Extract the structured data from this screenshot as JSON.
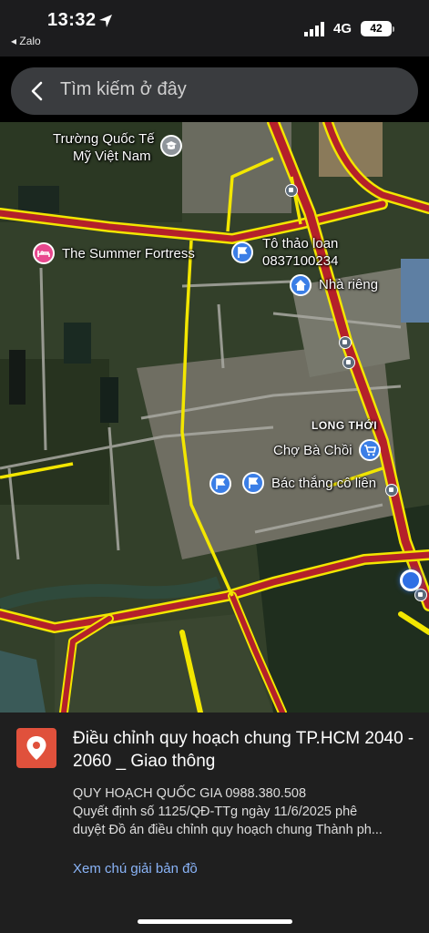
{
  "status_bar": {
    "time": "13:32",
    "back_app": "◂ Zalo",
    "network": "4G",
    "battery": "42"
  },
  "search": {
    "placeholder": "Tìm kiếm ở đây"
  },
  "map": {
    "labels": {
      "school_line1": "Trường Quốc Tế",
      "school_line2": "Mỹ Việt Nam",
      "summer_fortress": "The Summer Fortress",
      "to_thao_loan_line1": "Tô thảo loan",
      "to_thao_loan_line2": "0837100234",
      "nha_rieng": "Nhà riêng",
      "long_thoi": "LONG THỚI",
      "cho_ba_choi": "Chợ Bà Chồi",
      "bac_thang": "Bác thắng cô liên"
    },
    "colors": {
      "road_yellow": "#f2e600",
      "road_red": "#b4202a",
      "pin_blue": "#3b7ee6",
      "pin_pink": "#e8488e"
    }
  },
  "sheet": {
    "title": "Điều chỉnh quy hoạch chung TP.HCM 2040 - 2060 _ Giao thông",
    "line1": "QUY HOẠCH QUỐC GIA 0988.380.508",
    "line2": "Quyết định số 1125/QĐ-TTg ngày 11/6/2025 phê",
    "line3": "duyệt Đồ án điều chỉnh quy hoạch chung Thành ph...",
    "legend_link": "Xem chú giải bản đồ",
    "icon": "map-pin-icon"
  }
}
